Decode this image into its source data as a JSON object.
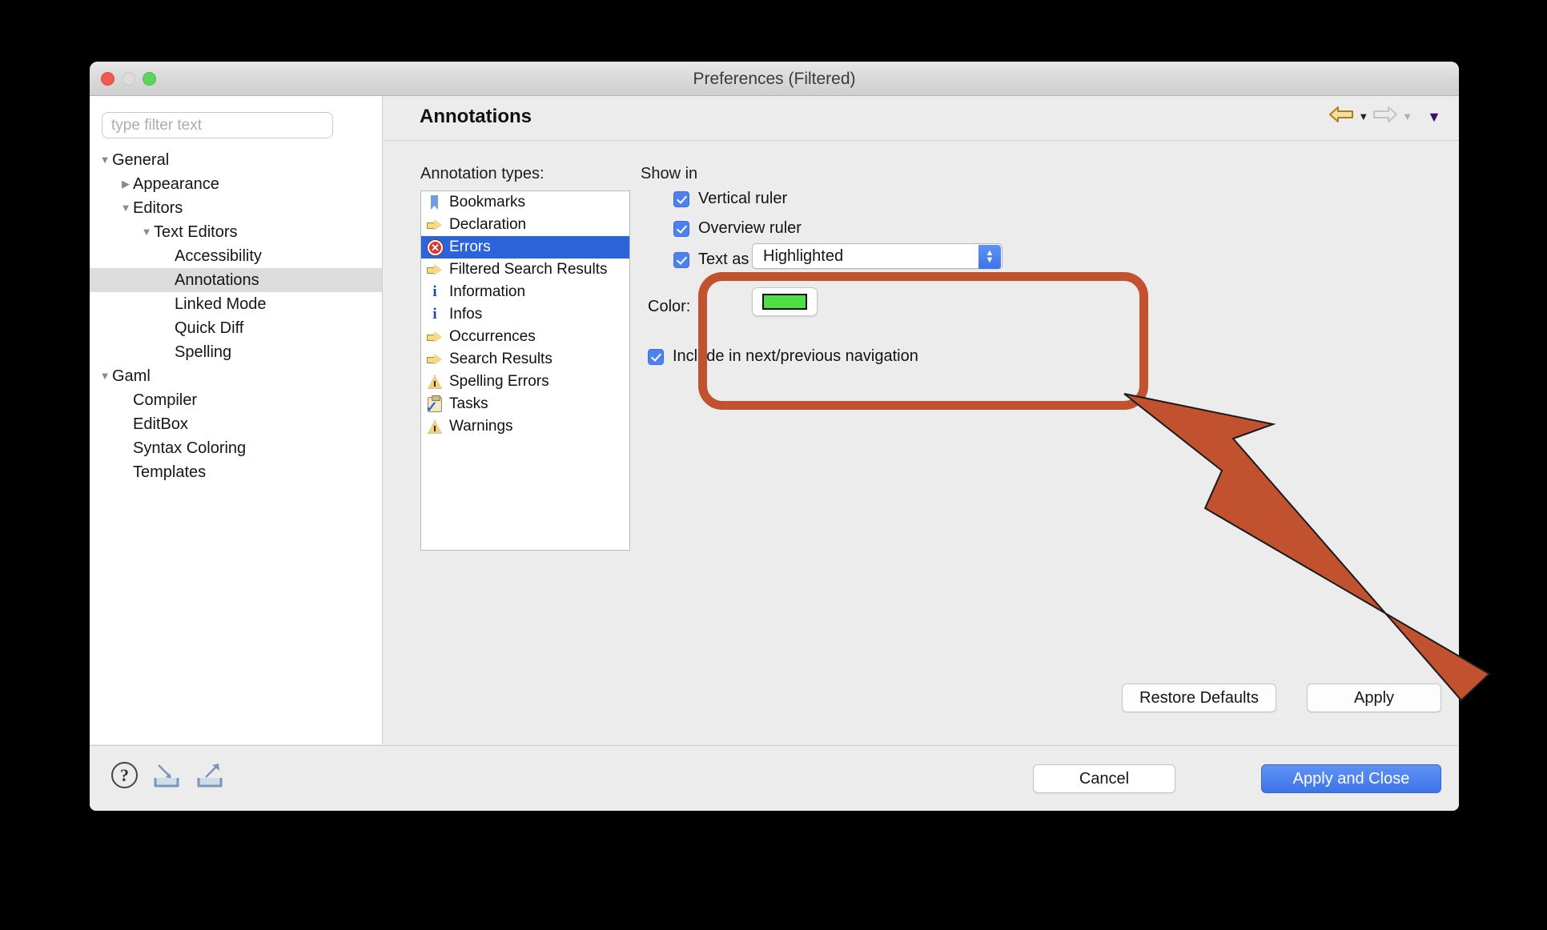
{
  "window": {
    "title": "Preferences (Filtered)",
    "traffic_lights": [
      "close",
      "minimize",
      "zoom"
    ]
  },
  "filter": {
    "placeholder": "type filter text",
    "value": ""
  },
  "tree": {
    "items": [
      {
        "label": "General",
        "indent": 0,
        "twisty": "down",
        "selected": false
      },
      {
        "label": "Appearance",
        "indent": 1,
        "twisty": "right",
        "selected": false
      },
      {
        "label": "Editors",
        "indent": 1,
        "twisty": "down",
        "selected": false
      },
      {
        "label": "Text Editors",
        "indent": 2,
        "twisty": "down",
        "selected": false
      },
      {
        "label": "Accessibility",
        "indent": 3,
        "twisty": "none",
        "selected": false
      },
      {
        "label": "Annotations",
        "indent": 3,
        "twisty": "none",
        "selected": true
      },
      {
        "label": "Linked Mode",
        "indent": 3,
        "twisty": "none",
        "selected": false
      },
      {
        "label": "Quick Diff",
        "indent": 3,
        "twisty": "none",
        "selected": false
      },
      {
        "label": "Spelling",
        "indent": 3,
        "twisty": "none",
        "selected": false
      },
      {
        "label": "Gaml",
        "indent": 0,
        "twisty": "down",
        "selected": false
      },
      {
        "label": "Compiler",
        "indent": 1,
        "twisty": "none",
        "selected": false
      },
      {
        "label": "EditBox",
        "indent": 1,
        "twisty": "none",
        "selected": false
      },
      {
        "label": "Syntax Coloring",
        "indent": 1,
        "twisty": "none",
        "selected": false
      },
      {
        "label": "Templates",
        "indent": 1,
        "twisty": "none",
        "selected": false
      }
    ]
  },
  "page": {
    "title": "Annotations",
    "nav": {
      "back_icon": "back-arrow-icon",
      "forward_icon": "forward-arrow-icon",
      "menu_icon": "chevron-down-icon"
    }
  },
  "annotation_types": {
    "label": "Annotation types:",
    "items": [
      {
        "label": "Bookmarks",
        "icon": "bookmark-icon",
        "selected": false
      },
      {
        "label": "Declaration",
        "icon": "arrow-right-icon",
        "selected": false
      },
      {
        "label": "Errors",
        "icon": "error-icon",
        "selected": true
      },
      {
        "label": "Filtered Search Results",
        "icon": "arrow-right-icon",
        "selected": false
      },
      {
        "label": "Information",
        "icon": "info-icon",
        "selected": false
      },
      {
        "label": "Infos",
        "icon": "info-icon",
        "selected": false
      },
      {
        "label": "Occurrences",
        "icon": "arrow-right-icon",
        "selected": false
      },
      {
        "label": "Search Results",
        "icon": "arrow-right-icon",
        "selected": false
      },
      {
        "label": "Spelling Errors",
        "icon": "warning-icon",
        "selected": false
      },
      {
        "label": "Tasks",
        "icon": "task-icon",
        "selected": false
      },
      {
        "label": "Warnings",
        "icon": "warning-icon",
        "selected": false
      }
    ]
  },
  "show_in": {
    "group_label": "Show in",
    "vertical_ruler": {
      "label": "Vertical ruler",
      "checked": true
    },
    "overview_ruler": {
      "label": "Overview ruler",
      "checked": true
    },
    "text_as": {
      "label": "Text as",
      "checked": true,
      "value": "Highlighted"
    },
    "color": {
      "label": "Color:",
      "value": "#4ede46"
    },
    "include_navigation": {
      "label": "Include in next/previous navigation",
      "checked": true
    }
  },
  "buttons": {
    "restore_defaults": "Restore Defaults",
    "apply": "Apply",
    "cancel": "Cancel",
    "apply_and_close": "Apply and Close"
  },
  "footer_icons": {
    "help": "help-icon",
    "import": "import-icon",
    "export": "export-icon"
  },
  "annotation_overlay": {
    "highlight_color": "#c2522f",
    "shapes": [
      "rounded-rect-callout",
      "pointer-arrow"
    ]
  }
}
